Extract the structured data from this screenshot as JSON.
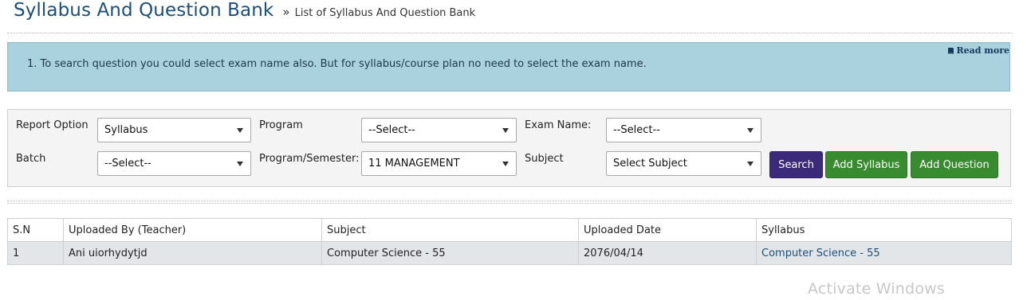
{
  "header": {
    "title": "Syllabus And Question Bank",
    "breadcrumb_sep": "»",
    "breadcrumb": "List of Syllabus And Question Bank"
  },
  "info": {
    "text": "1. To search question you could select exam name also. But for syllabus/course plan no need to select the exam name.",
    "read_more": "Read more",
    "read_more_icon": "book-icon"
  },
  "filters": {
    "report_option": {
      "label": "Report Option",
      "value": "Syllabus"
    },
    "program": {
      "label": "Program",
      "value": "--Select--"
    },
    "exam_name": {
      "label": "Exam Name:",
      "value": "--Select--"
    },
    "batch": {
      "label": "Batch",
      "value": "--Select--"
    },
    "program_semester": {
      "label": "Program/Semester:",
      "value": "11 MANAGEMENT"
    },
    "subject": {
      "label": "Subject",
      "value": "Select Subject"
    }
  },
  "buttons": {
    "search": "Search",
    "add_syllabus": "Add Syllabus",
    "add_question": "Add Question"
  },
  "table": {
    "columns": [
      "S.N",
      "Uploaded By (Teacher)",
      "Subject",
      "Uploaded Date",
      "Syllabus"
    ],
    "rows": [
      [
        "1",
        "Ani uiorhydytjd",
        "Computer Science - 55",
        "2076/04/14",
        "Computer Science - 55"
      ]
    ]
  },
  "watermark": "Activate Windows",
  "colors": {
    "title": "#1b4f7a",
    "info_bg": "#a9d1de",
    "search_btn": "#3a2a79",
    "green_btn": "#388c2f"
  }
}
